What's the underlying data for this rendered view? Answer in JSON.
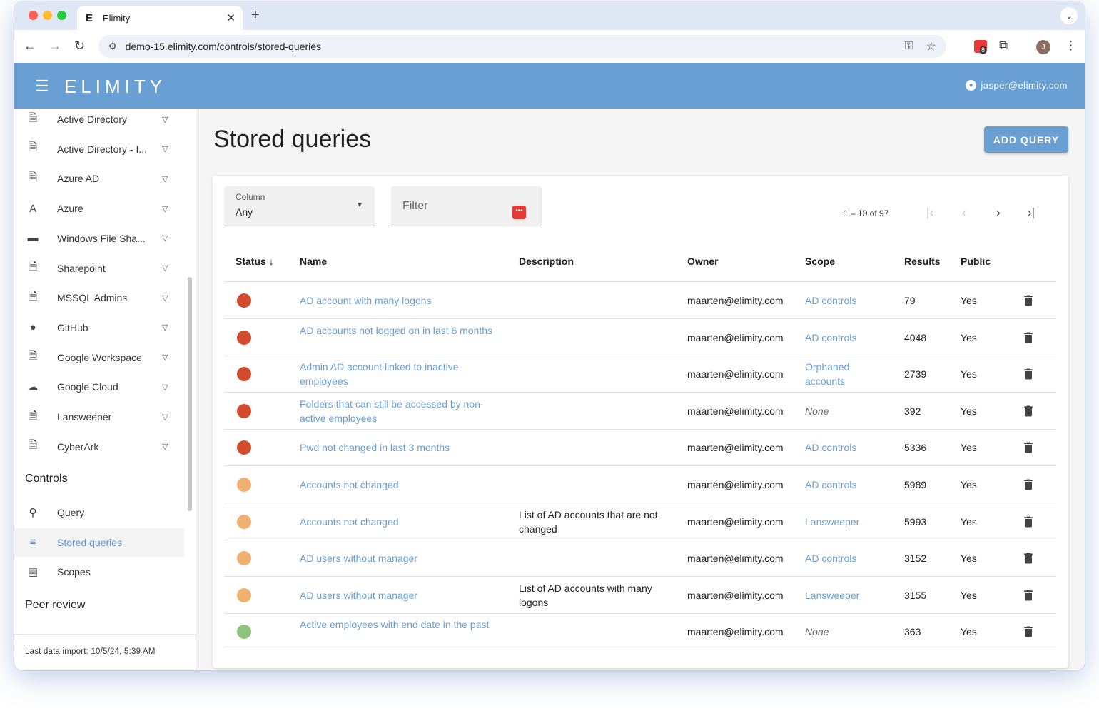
{
  "browser": {
    "tab_favicon": "E",
    "tab_title": "Elimity",
    "tab_close": "✕",
    "new_tab": "+",
    "url": "demo-15.elimity.com/controls/stored-queries",
    "ext_count": "8",
    "profile_initial": "J"
  },
  "app": {
    "logo": "ELIMITY",
    "user_email": "jasper@elimity.com"
  },
  "sidebar": {
    "sources": [
      {
        "label": "Active Directory",
        "icon": "document-icon"
      },
      {
        "label": "Active Directory - I...",
        "icon": "document-icon"
      },
      {
        "label": "Azure AD",
        "icon": "document-icon"
      },
      {
        "label": "Azure",
        "icon": "azure-icon"
      },
      {
        "label": "Windows File Sha...",
        "icon": "drive-icon"
      },
      {
        "label": "Sharepoint",
        "icon": "document-icon"
      },
      {
        "label": "MSSQL Admins",
        "icon": "document-icon"
      },
      {
        "label": "GitHub",
        "icon": "github-icon"
      },
      {
        "label": "Google Workspace",
        "icon": "document-icon"
      },
      {
        "label": "Google Cloud",
        "icon": "cloud-icon"
      },
      {
        "label": "Lansweeper",
        "icon": "document-icon"
      },
      {
        "label": "CyberArk",
        "icon": "document-icon"
      }
    ],
    "controls_heading": "Controls",
    "controls": [
      {
        "label": "Query",
        "icon": "search-icon"
      },
      {
        "label": "Stored queries",
        "icon": "list-icon"
      },
      {
        "label": "Scopes",
        "icon": "scopes-icon"
      }
    ],
    "peer_review_heading": "Peer review",
    "footer": "Last data import: 10/5/24, 5:39 AM"
  },
  "main": {
    "title": "Stored queries",
    "add_button": "ADD QUERY",
    "column_label": "Column",
    "column_value": "Any",
    "filter_placeholder": "Filter",
    "pager_text": "1 – 10 of 97",
    "headers": {
      "status": "Status ↓",
      "name": "Name",
      "description": "Description",
      "owner": "Owner",
      "scope": "Scope",
      "results": "Results",
      "public": "Public"
    },
    "status_colors": {
      "red": "#d24c2d",
      "orange": "#f0b070",
      "green": "#8fc47c"
    },
    "rows": [
      {
        "status": "red",
        "name": "AD account with many logons",
        "description": "",
        "owner": "maarten@elimity.com",
        "scope": "AD controls",
        "scope_none": false,
        "results": "79",
        "public": "Yes"
      },
      {
        "status": "red",
        "name": "AD accounts not logged on in last 6 months",
        "description": "",
        "owner": "maarten@elimity.com",
        "scope": "AD controls",
        "scope_none": false,
        "results": "4048",
        "public": "Yes"
      },
      {
        "status": "red",
        "name": "Admin AD account linked to inactive employees",
        "description": "",
        "owner": "maarten@elimity.com",
        "scope": "Orphaned accounts",
        "scope_none": false,
        "results": "2739",
        "public": "Yes"
      },
      {
        "status": "red",
        "name": "Folders that can still be accessed by non-active employees",
        "description": "",
        "owner": "maarten@elimity.com",
        "scope": "None",
        "scope_none": true,
        "results": "392",
        "public": "Yes"
      },
      {
        "status": "red",
        "name": "Pwd not changed in last 3 months",
        "description": "",
        "owner": "maarten@elimity.com",
        "scope": "AD controls",
        "scope_none": false,
        "results": "5336",
        "public": "Yes"
      },
      {
        "status": "orange",
        "name": "Accounts not changed",
        "description": "",
        "owner": "maarten@elimity.com",
        "scope": "AD controls",
        "scope_none": false,
        "results": "5989",
        "public": "Yes"
      },
      {
        "status": "orange",
        "name": "Accounts not changed",
        "description": "List of AD accounts that are not changed",
        "owner": "maarten@elimity.com",
        "scope": "Lansweeper",
        "scope_none": false,
        "results": "5993",
        "public": "Yes"
      },
      {
        "status": "orange",
        "name": "AD users without manager",
        "description": "",
        "owner": "maarten@elimity.com",
        "scope": "AD controls",
        "scope_none": false,
        "results": "3152",
        "public": "Yes"
      },
      {
        "status": "orange",
        "name": "AD users without manager",
        "description": "List of AD accounts with many logons",
        "owner": "maarten@elimity.com",
        "scope": "Lansweeper",
        "scope_none": false,
        "results": "3155",
        "public": "Yes"
      },
      {
        "status": "green",
        "name": "Active employees with end date in the past",
        "description": "",
        "owner": "maarten@elimity.com",
        "scope": "None",
        "scope_none": true,
        "results": "363",
        "public": "Yes"
      }
    ]
  }
}
